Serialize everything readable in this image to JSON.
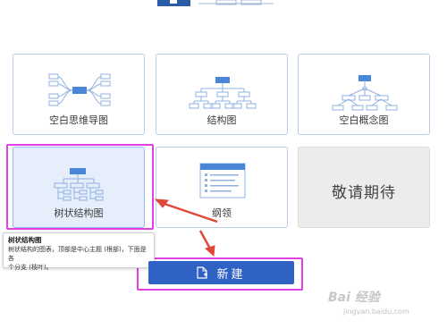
{
  "templates": [
    {
      "label": "空白思维导图",
      "icon": "mind-map-icon"
    },
    {
      "label": "结构图",
      "icon": "org-chart-icon"
    },
    {
      "label": "空白概念图",
      "icon": "concept-map-icon"
    },
    {
      "label": "树状结构图",
      "icon": "tree-chart-icon"
    },
    {
      "label": "纲领",
      "icon": "outline-icon"
    },
    {
      "label": "敬请期待",
      "icon": ""
    }
  ],
  "tooltip": {
    "title": "树状结构图",
    "body_line1": "树状结构的图表，顶部是中心主题 (根部)，下面是各",
    "body_line2": "个分支 (枝叶)。"
  },
  "new_button": {
    "label": "新建",
    "icon": "new-file-icon"
  },
  "watermark": {
    "main": "Bai 经验",
    "sub": "jingyan.baidu.com"
  },
  "colors": {
    "accent": "#2f62c4",
    "card_border": "#b8cbe8",
    "selected_bg": "#e6eefb",
    "highlight": "#e040e6",
    "arrow": "#e0483a"
  }
}
